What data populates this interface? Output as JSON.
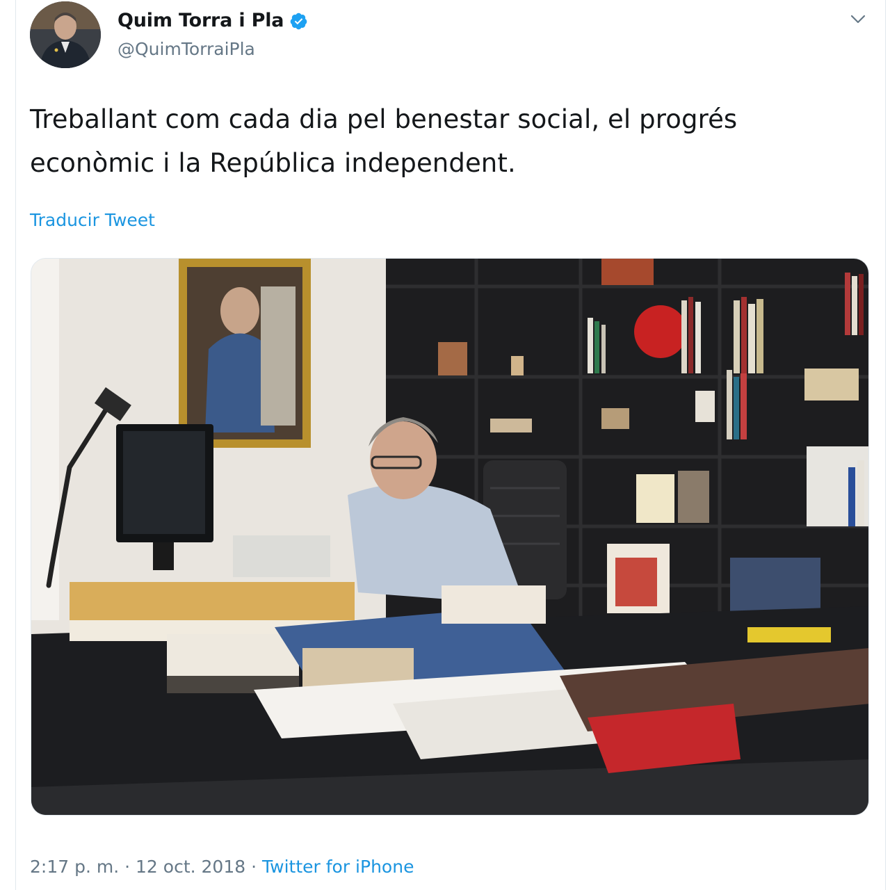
{
  "tweet": {
    "author": {
      "display_name": "Quim Torra i Pla",
      "handle": "@QuimTorraiPla",
      "verified": true
    },
    "text": "Treballant com cada dia pel benestar social, el progrés econòmic i la República independent.",
    "translate_label": "Traducir Tweet",
    "media": {
      "description": "Photo of a man working at a desk covered in books and folders in an office with shelves and a framed painting"
    },
    "timestamp": {
      "time": "2:17 p. m.",
      "separator": "·",
      "date": "12 oct. 2018",
      "source": "Twitter for iPhone"
    }
  },
  "icons": {
    "verified": "verified-badge-icon",
    "more": "chevron-down-icon"
  },
  "colors": {
    "text_primary": "#14171a",
    "text_secondary": "#657786",
    "link": "#1b95e0",
    "verified": "#1da1f2"
  }
}
